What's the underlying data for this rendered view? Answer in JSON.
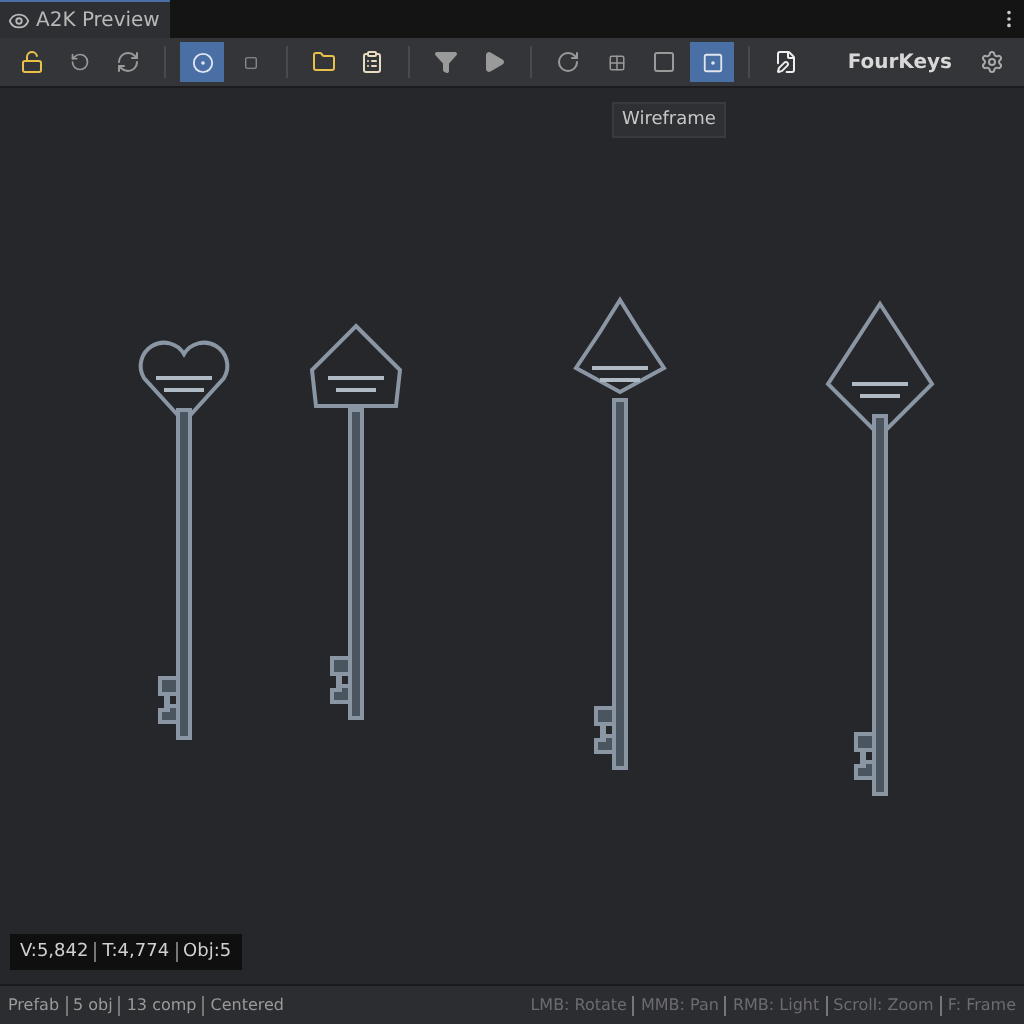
{
  "window": {
    "title": "A2K Preview"
  },
  "toolbar": {
    "groups": [
      [
        {
          "kind": "unlock",
          "selected": false
        },
        {
          "kind": "undo",
          "selected": false
        },
        {
          "kind": "reset",
          "selected": false
        }
      ],
      [
        {
          "kind": "orbit",
          "selected": true
        },
        {
          "kind": "bracket",
          "selected": false
        }
      ],
      [
        {
          "kind": "folder",
          "selected": false
        },
        {
          "kind": "clipboard",
          "selected": false
        }
      ],
      [
        {
          "kind": "filter",
          "selected": false
        },
        {
          "kind": "play",
          "selected": false
        }
      ],
      [
        {
          "kind": "redo",
          "selected": false
        },
        {
          "kind": "grid",
          "selected": false
        },
        {
          "kind": "square",
          "selected": false
        },
        {
          "kind": "wireframe",
          "selected": true
        }
      ],
      [
        {
          "kind": "edit",
          "selected": false
        }
      ]
    ],
    "project": "FourKeys"
  },
  "tooltip": "Wireframe",
  "stats": [
    "V:5,842",
    "T:4,774",
    "Obj:5"
  ],
  "status_bar": {
    "left": [
      "Prefab",
      "5 obj",
      "13 comp",
      "Centered"
    ],
    "right": [
      "LMB: Rotate",
      "MMB: Pan",
      "RMB: Light",
      "Scroll: Zoom",
      "F: Frame"
    ]
  }
}
